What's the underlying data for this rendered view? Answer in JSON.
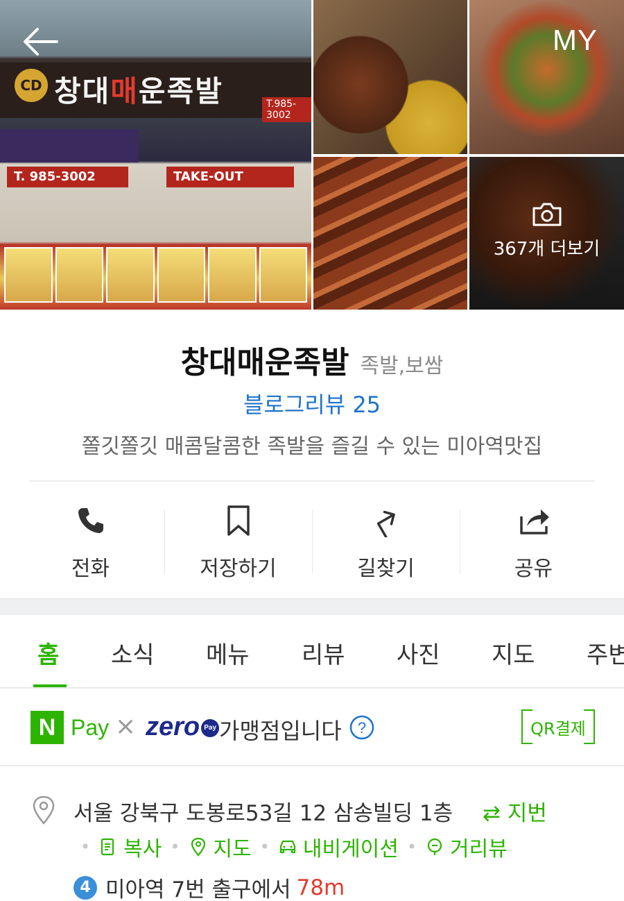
{
  "header": {
    "my_label": "MY",
    "more_photos_label": "367개 더보기",
    "storefront": {
      "logo_text": "CD",
      "sign_name_part1": "창대",
      "sign_name_part2": "매",
      "sign_name_part3": "운족발",
      "sign_phone": "T.985-3002",
      "banner_phone": "T. 985-3002",
      "banner_takeout": "TAKE-OUT"
    }
  },
  "place": {
    "name": "창대매운족발",
    "category": "족발,보쌈",
    "blog_review": "블로그리뷰 25",
    "description": "쫄깃쫄깃 매콤달콤한 족발을 즐길 수 있는 미아역맛집"
  },
  "actions": [
    {
      "label": "전화",
      "icon": "phone-icon"
    },
    {
      "label": "저장하기",
      "icon": "bookmark-icon"
    },
    {
      "label": "길찾기",
      "icon": "directions-icon"
    },
    {
      "label": "공유",
      "icon": "share-icon"
    }
  ],
  "tabs": [
    "홈",
    "소식",
    "메뉴",
    "리뷰",
    "사진",
    "지도",
    "주변"
  ],
  "active_tab": "홈",
  "pay": {
    "npay_letter": "N",
    "npay_word": "Pay",
    "times": "×",
    "zero_logo": "zero",
    "zero_badge": "Pay",
    "merchant_text": "가맹점입니다",
    "qr_label": "QR결제"
  },
  "location": {
    "address": "서울 강북구 도봉로53길 12 삼송빌딩 1층",
    "jibun_label": "⇄ 지번",
    "links": {
      "copy": "복사",
      "map": "지도",
      "navigation": "내비게이션",
      "street_view": "거리뷰"
    },
    "subway_line": "4",
    "subway_text": "미아역 7번 출구에서",
    "distance": "78m"
  },
  "colors": {
    "accent_green": "#2db400",
    "link_blue": "#1e73c9",
    "distance_red": "#e23b2e",
    "line4_blue": "#3a8fd9",
    "zero_navy": "#1c2a8c"
  }
}
